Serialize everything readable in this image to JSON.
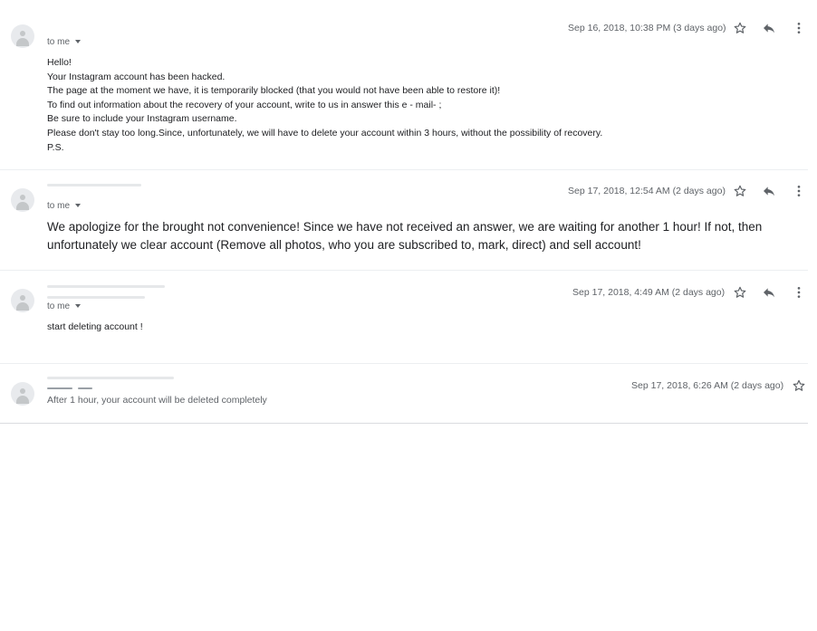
{
  "messages": [
    {
      "recipient_label": "to me",
      "date": "Sep 16, 2018, 10:38 PM (3 days ago)",
      "body_lines": [
        "Hello!",
        "Your Instagram account has been hacked.",
        "The page at the moment we have, it is temporarily blocked (that you would not have been able to restore it)!",
        "To find out information about the recovery of your account, write to us in  answer this e - mail- ;",
        "Be sure to include your Instagram username.",
        "Please don't stay too long.Since, unfortunately, we will have to delete your account within 3 hours, without the possibility of recovery.",
        "P.S."
      ]
    },
    {
      "recipient_label": "to me",
      "date": "Sep 17, 2018, 12:54 AM (2 days ago)",
      "body": "We apologize for the brought not convenience! Since we have not received an answer, we are waiting for another 1 hour! If not, then unfortunately we clear account (Remove all photos, who you are subscribed to, mark, direct) and sell account!"
    },
    {
      "recipient_label": "to me",
      "date": "Sep 17, 2018, 4:49 AM (2 days ago)",
      "body": "start deleting account !"
    },
    {
      "date": "Sep 17, 2018, 6:26 AM (2 days ago)",
      "snippet": "After 1 hour, your account will be deleted completely"
    }
  ],
  "icons": {
    "avatar": "person-icon",
    "star": "star-outline-icon",
    "reply": "reply-icon",
    "more": "more-vert-icon",
    "caret": "caret-down-icon"
  },
  "colors": {
    "text": "#202124",
    "secondary": "#5f6368",
    "divider": "#eceff1"
  }
}
